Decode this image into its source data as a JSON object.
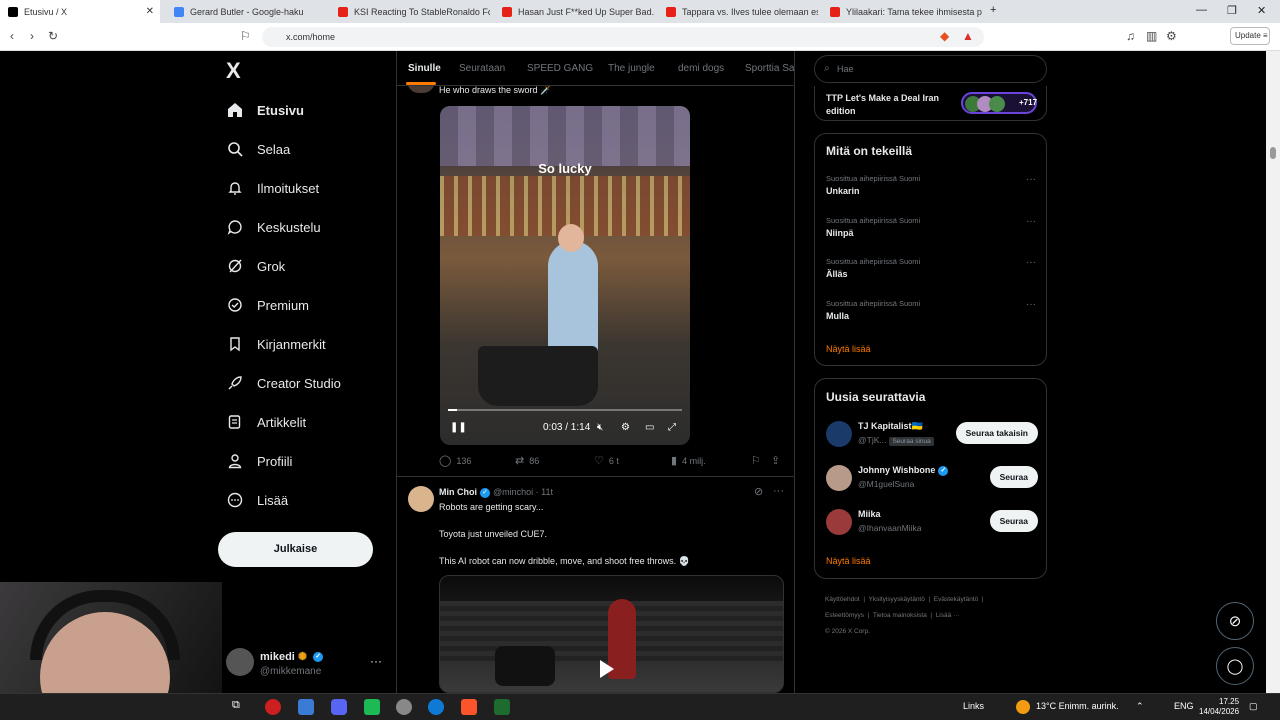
{
  "browser": {
    "tabs": [
      {
        "title": "Etusivu / X",
        "active": true
      },
      {
        "title": "Gerard Butler - Google-haku"
      },
      {
        "title": "KSI Reacting To StableRonaldo For 3..."
      },
      {
        "title": "Hasan Just F**ked Up Super Bad..."
      },
      {
        "title": "Tappara vs. Ilves tulee olemaan espp..."
      },
      {
        "title": "Ylilaakari: Tama tekee ihmisesta paha..."
      }
    ],
    "url": "x.com/home",
    "update_label": "Update"
  },
  "sidebar": {
    "logo": "X",
    "items": [
      {
        "label": "Etusivu",
        "icon": "home-icon"
      },
      {
        "label": "Selaa",
        "icon": "search-icon"
      },
      {
        "label": "Ilmoitukset",
        "icon": "bell-icon"
      },
      {
        "label": "Keskustelu",
        "icon": "chat-icon"
      },
      {
        "label": "Grok",
        "icon": "grok-icon"
      },
      {
        "label": "Premium",
        "icon": "premium-icon"
      },
      {
        "label": "Kirjanmerkit",
        "icon": "bookmark-icon"
      },
      {
        "label": "Creator Studio",
        "icon": "rocket-icon"
      },
      {
        "label": "Artikkelit",
        "icon": "article-icon"
      },
      {
        "label": "Profiili",
        "icon": "person-icon"
      },
      {
        "label": "Lisää",
        "icon": "more-circle-icon"
      }
    ],
    "post_button": "Julkaise",
    "account": {
      "name": "mikedi",
      "handle": "@mikkemane"
    }
  },
  "feed": {
    "tabs": [
      "Sinulle",
      "Seurataan",
      "SPEED GANG",
      "The jungle",
      "demi dogs",
      "Sporttia Sa"
    ],
    "tweet1": {
      "text": "He who draws the sword 🗡️",
      "video_caption": "So lucky",
      "video_time": "0:03 / 1:14",
      "video_progress": 0.04,
      "replies": "136",
      "reposts": "86",
      "likes": "6 t",
      "views": "4 milj."
    },
    "tweet2": {
      "name": "Min Choi",
      "handle": "@minchoi",
      "time": "· 11t",
      "line1": "Robots are getting scary...",
      "line2": "Toyota just unveiled CUE7.",
      "line3": "This AI robot can now dribble, move, and shoot free throws. 💀"
    }
  },
  "right": {
    "search_placeholder": "Hae",
    "spaces": {
      "title": "TTP Let's Make a Deal Iran edition",
      "count": "+717"
    },
    "trends": {
      "title": "Mitä on tekeillä",
      "items": [
        {
          "context": "Suosittua aihepiirissä Suomi",
          "name": "Unkarin"
        },
        {
          "context": "Suosittua aihepiirissä Suomi",
          "name": "Niinpä"
        },
        {
          "context": "Suosittua aihepiirissä Suomi",
          "name": "Älläs"
        },
        {
          "context": "Suosittua aihepiirissä Suomi",
          "name": "Mulla"
        }
      ],
      "show_more": "Näytä lisää"
    },
    "follow": {
      "title": "Uusia seurattavia",
      "items": [
        {
          "name": "TJ Kapitalist🇺🇦",
          "handle": "@TjK...",
          "badge": "Seuraa sinua",
          "button": "Seuraa takaisin"
        },
        {
          "name": "Johnny Wishbone",
          "handle": "@M1guelSuna",
          "button": "Seuraa"
        },
        {
          "name": "Miika",
          "handle": "@IhanvaanMiika",
          "button": "Seuraa"
        }
      ],
      "show_more": "Näytä lisää"
    },
    "footer": [
      "Käyttöehdot",
      "Yksityisyyskäytäntö",
      "Evästekäytäntö",
      "Esteettömyys",
      "Tietoa mainoksista",
      "Lisää ···",
      "© 2026 X Corp."
    ]
  },
  "taskbar": {
    "links_label": "Links",
    "weather": "13°C  Enimm. aurink.",
    "lang": "ENG",
    "time": "17.25",
    "date": "14/04/2026"
  },
  "colors": {
    "accent": "#ff7a00",
    "verified": "#1d9bf0",
    "bg": "#000000"
  }
}
